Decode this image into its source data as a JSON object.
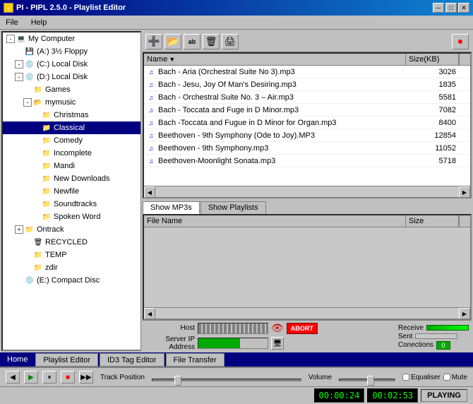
{
  "titleBar": {
    "icon": "♪",
    "title": "PI - PIPL 2.5.0 - Playlist Editor",
    "btnMin": "─",
    "btnMax": "□",
    "btnClose": "✕"
  },
  "menu": {
    "items": [
      "File",
      "Help"
    ]
  },
  "toolbar": {
    "buttons": [
      {
        "name": "add-green",
        "icon": "➕",
        "label": "Add"
      },
      {
        "name": "add-folder",
        "icon": "📁",
        "label": "Add Folder"
      },
      {
        "name": "rename",
        "icon": "ab",
        "label": "Rename"
      },
      {
        "name": "delete",
        "icon": "🗑",
        "label": "Delete"
      },
      {
        "name": "print",
        "icon": "🖨",
        "label": "Print"
      },
      {
        "name": "stop-red",
        "icon": "◯",
        "label": "Stop"
      }
    ]
  },
  "fileList": {
    "columns": [
      {
        "name": "Name",
        "arrow": "▼"
      },
      {
        "name": "Size(KB)"
      }
    ],
    "files": [
      {
        "name": "Bach - Aria (Orchestral Suite No 3).mp3",
        "size": "3026"
      },
      {
        "name": "Bach - Jesu, Joy Of Man's Desiring.mp3",
        "size": "1835"
      },
      {
        "name": "Bach - Orchestral Suite No. 3 – Air.mp3",
        "size": "5581"
      },
      {
        "name": "Bach - Toccata and Fuge in D Minor.mp3",
        "size": "7082"
      },
      {
        "name": "Bach -Toccata and Fugue in D Minor for Organ.mp3",
        "size": "8400"
      },
      {
        "name": "Beethoven - 9th Symphony (Ode to Joy).MP3",
        "size": "12854"
      },
      {
        "name": "Beethoven - 9th Symphony.mp3",
        "size": "11052"
      },
      {
        "name": "Beethoven-Moonlight Sonata.mp3",
        "size": "5718"
      }
    ]
  },
  "tabs": {
    "showMp3s": "Show MP3s",
    "showPlaylists": "Show Playlists",
    "active": "showMp3s"
  },
  "playlist": {
    "columns": [
      {
        "name": "File Name"
      },
      {
        "name": "Size"
      }
    ],
    "files": []
  },
  "connectionBar": {
    "hostLabel": "Host",
    "hostValue": "▓▓▓▓▓▓▓▓",
    "serverIPLabel": "Server IP Address",
    "serverIPValue": "▓▓▓▓▓▓▓▓▓▓▓▓",
    "receiveLabel": "Receive",
    "sentLabel": "Sent",
    "connectionsLabel": "Conections",
    "connectionsValue": "0",
    "eyeIcon": "👁",
    "abortLabel": "ABORT"
  },
  "bottomTabs": {
    "home": "Home",
    "playlistEditor": "Playlist Editor",
    "id3TagEditor": "ID3 Tag Editor",
    "fileTransfer": "File Transfer"
  },
  "player": {
    "btnPrev": "◀",
    "btnPlay": "▶",
    "btnPause": "⏸",
    "btnStop": "■",
    "btnNext": "▶▶",
    "trackLabel": "Track Position",
    "volumeLabel": "Volume",
    "equalizerLabel": "Equaliser",
    "muteLabel": "Mute"
  },
  "statusBar": {
    "timeElapsed": "00:00:24",
    "timeTotal": "00:02:53",
    "status": "PLAYING"
  },
  "treeView": {
    "items": [
      {
        "id": "mycomputer",
        "level": 0,
        "label": "My Computer",
        "icon": "💻",
        "expand": "-",
        "indent": "indent1"
      },
      {
        "id": "floppy",
        "level": 1,
        "label": "(A:) 3½ Floppy",
        "icon": "💾",
        "expand": "",
        "indent": "indent2"
      },
      {
        "id": "c-drive",
        "level": 1,
        "label": "(C:) Local Disk",
        "icon": "💿",
        "expand": "-",
        "indent": "indent2"
      },
      {
        "id": "d-drive",
        "level": 1,
        "label": "(D:) Local Disk",
        "icon": "💿",
        "expand": "-",
        "indent": "indent2"
      },
      {
        "id": "games",
        "level": 2,
        "label": "Games",
        "icon": "📁",
        "expand": "",
        "indent": "indent3"
      },
      {
        "id": "mymusic",
        "level": 2,
        "label": "mymusic",
        "icon": "📂",
        "expand": "-",
        "indent": "indent3"
      },
      {
        "id": "christmas",
        "level": 3,
        "label": "Christmas",
        "icon": "📁",
        "expand": "",
        "indent": "indent4"
      },
      {
        "id": "classical",
        "level": 3,
        "label": "Classical",
        "icon": "📁",
        "expand": "",
        "indent": "indent4",
        "selected": true
      },
      {
        "id": "comedy",
        "level": 3,
        "label": "Comedy",
        "icon": "📁",
        "expand": "",
        "indent": "indent4"
      },
      {
        "id": "incomplete",
        "level": 3,
        "label": "Incomplete",
        "icon": "📁",
        "expand": "",
        "indent": "indent4"
      },
      {
        "id": "mandi",
        "level": 3,
        "label": "Mandi",
        "icon": "📁",
        "expand": "",
        "indent": "indent4"
      },
      {
        "id": "newdownloads",
        "level": 3,
        "label": "New Downloads",
        "icon": "📁",
        "expand": "",
        "indent": "indent4"
      },
      {
        "id": "newfile",
        "level": 3,
        "label": "Newfile",
        "icon": "📁",
        "expand": "",
        "indent": "indent4"
      },
      {
        "id": "soundtracks",
        "level": 3,
        "label": "Soundtracks",
        "icon": "📁",
        "expand": "",
        "indent": "indent4"
      },
      {
        "id": "spokenword",
        "level": 3,
        "label": "Spoken Word",
        "icon": "📁",
        "expand": "",
        "indent": "indent4"
      },
      {
        "id": "ontrack",
        "level": 1,
        "label": "Ontrack",
        "icon": "📁",
        "expand": "+",
        "indent": "indent2"
      },
      {
        "id": "recycled",
        "level": 2,
        "label": "RECYCLED",
        "icon": "🗑",
        "expand": "",
        "indent": "indent3"
      },
      {
        "id": "temp",
        "level": 2,
        "label": "TEMP",
        "icon": "📁",
        "expand": "",
        "indent": "indent3"
      },
      {
        "id": "zdir",
        "level": 2,
        "label": "zdir",
        "icon": "📁",
        "expand": "",
        "indent": "indent3"
      },
      {
        "id": "e-drive",
        "level": 1,
        "label": "(E:) Compact Disc",
        "icon": "💿",
        "expand": "",
        "indent": "indent2"
      }
    ]
  }
}
